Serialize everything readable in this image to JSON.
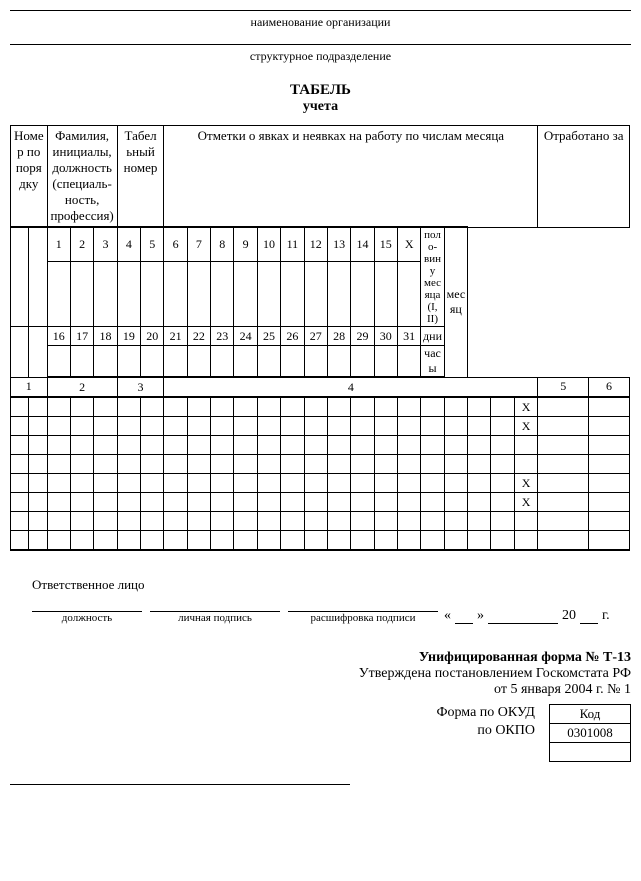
{
  "header": {
    "org_line": "наименование организации",
    "dept_line": "структурное подразделение",
    "title": "ТАБЕЛЬ",
    "subtitle": "учета"
  },
  "columns": {
    "c1": "Номер по порядку",
    "c2": "Фамилия, инициалы, должность (специаль­ность, профессия)",
    "c3": "Табель­ный номер",
    "c4": "Отметки о явках и неявках на работу по числам месяца",
    "c5": "Отработано за",
    "half_month": "поло­вину месяца (I, II)",
    "month": "месяц",
    "days": "дни",
    "hours": "часы",
    "n1": "1",
    "n2": "2",
    "n3": "3",
    "n4": "4",
    "n5": "5",
    "n6": "6"
  },
  "days": {
    "r1": [
      "1",
      "2",
      "3",
      "4",
      "5",
      "6",
      "7",
      "8",
      "9",
      "10",
      "11",
      "12",
      "13",
      "14",
      "15",
      "X"
    ],
    "r2": [
      "16",
      "17",
      "18",
      "19",
      "20",
      "21",
      "22",
      "23",
      "24",
      "25",
      "26",
      "27",
      "28",
      "29",
      "30",
      "31"
    ]
  },
  "rows_x": {
    "x_mark": "X"
  },
  "signature": {
    "label": "Ответственное лицо",
    "sub1": "должность",
    "sub2": "личная подпись",
    "sub3": "расшифровка подписи",
    "quote_open": "«",
    "quote_close": "»",
    "year20": "20",
    "year_suffix": "г."
  },
  "footer": {
    "form": "Унифицированная форма № Т-13",
    "approved": "Утверждена постановлением Госкомстата РФ",
    "date": "от 5 января 2004 г. № 1",
    "okud_label": "Форма по ОКУД",
    "okpo_label": "по ОКПО",
    "code_header": "Код",
    "code_value": "0301008"
  }
}
